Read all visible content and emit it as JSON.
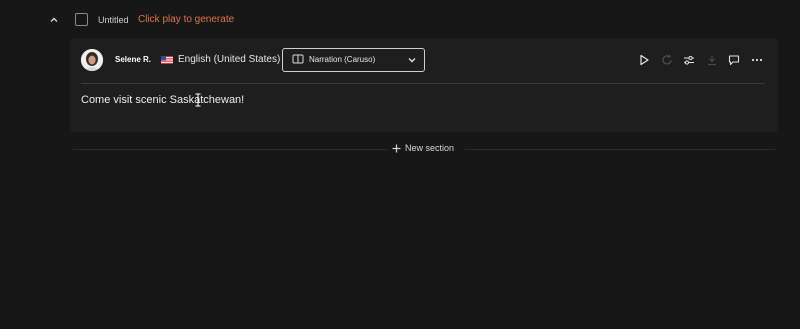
{
  "section": {
    "title": "Untitled",
    "hint": "Click play to generate",
    "hint_color": "#e0734f"
  },
  "speaker": {
    "name": "Selene R.",
    "language": "English (United States)",
    "flag_icon": "us-flag-icon"
  },
  "voice_select": {
    "value": "Narration (Caruso)"
  },
  "toolbar_icons": [
    "play-icon",
    "regenerate-icon",
    "sliders-icon",
    "download-icon",
    "comment-icon",
    "more-icon"
  ],
  "editor": {
    "text": "Come visit scenic Saskatchewan!"
  },
  "new_section": {
    "label": "New section"
  }
}
